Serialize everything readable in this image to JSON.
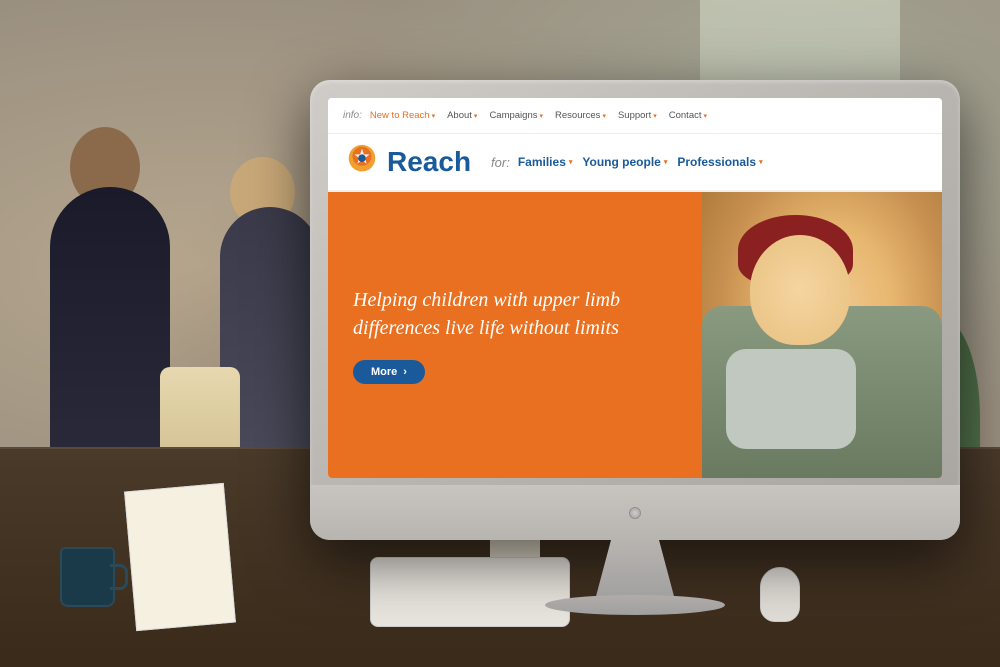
{
  "room": {
    "background_color": "#9a9080"
  },
  "monitor": {
    "brand": "iMac-style"
  },
  "website": {
    "nav_info_label": "info:",
    "nav_top_links": [
      {
        "label": "New to Reach",
        "has_chevron": true,
        "highlight": true
      },
      {
        "label": "About",
        "has_chevron": true
      },
      {
        "label": "Campaigns",
        "has_chevron": true
      },
      {
        "label": "Resources",
        "has_chevron": true
      },
      {
        "label": "Support",
        "has_chevron": true
      },
      {
        "label": "Contact",
        "has_chevron": true
      }
    ],
    "logo_text": "Reach",
    "for_label": "for:",
    "nav_for_links": [
      {
        "label": "Families",
        "has_chevron": true
      },
      {
        "label": "Young people",
        "has_chevron": true
      },
      {
        "label": "Professionals",
        "has_chevron": true
      }
    ],
    "hero_title": "Helping children with upper limb differences live life without limits",
    "hero_button_label": "More",
    "hero_button_arrow": "›"
  }
}
